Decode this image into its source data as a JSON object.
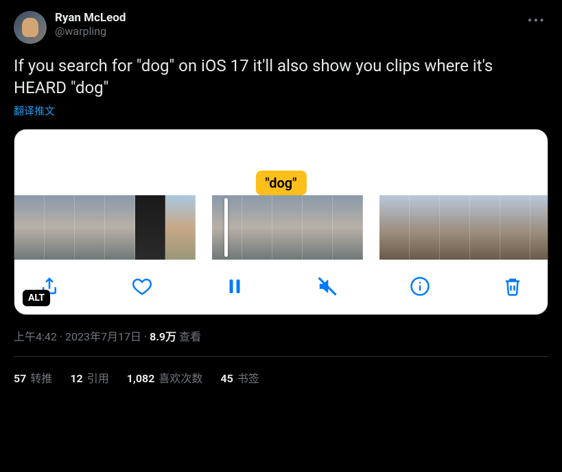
{
  "author": {
    "display_name": "Ryan McLeod",
    "handle": "@warpling"
  },
  "tweet_text": "If you search for \"dog\" on iOS 17 it'll also show you clips where it's HEARD \"dog\"",
  "translate_label": "翻译推文",
  "media": {
    "label": "\"dog\"",
    "alt_badge": "ALT"
  },
  "meta": {
    "time": "上午4:42",
    "date": "2023年7月17日",
    "views_count": "8.9万",
    "views_label": "查看",
    "separator": " · "
  },
  "stats": {
    "retweets": {
      "count": "57",
      "label": "转推"
    },
    "quotes": {
      "count": "12",
      "label": "引用"
    },
    "likes": {
      "count": "1,082",
      "label": "喜欢次数"
    },
    "bookmarks": {
      "count": "45",
      "label": "书签"
    }
  }
}
